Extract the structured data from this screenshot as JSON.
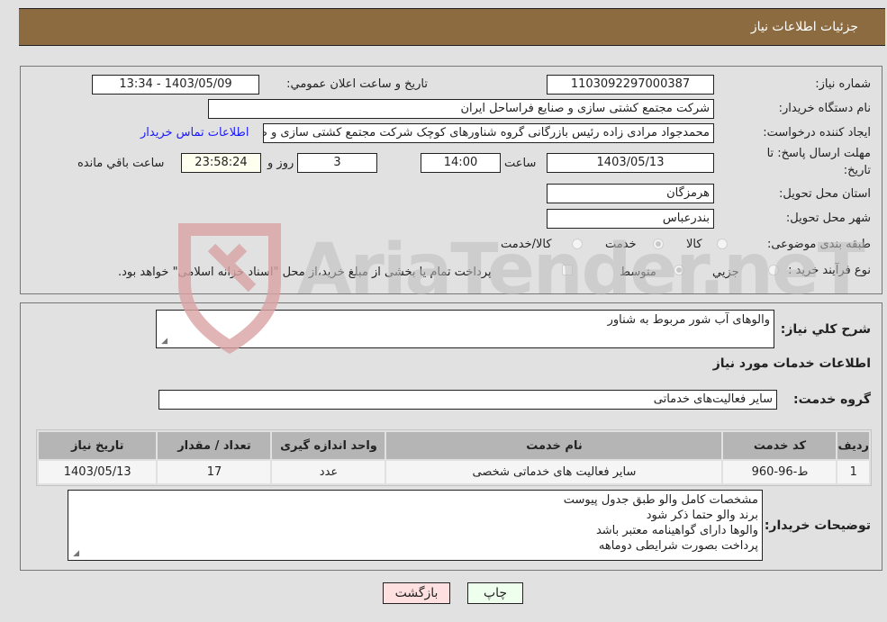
{
  "header": {
    "title": "جزئیات اطلاعات نیاز"
  },
  "info": {
    "need_number_label": "شماره نیاز:",
    "need_number": "1103092297000387",
    "announce_label": "تاریخ و ساعت اعلان عمومي:",
    "announce_value": "1403/05/09 - 13:34",
    "buyer_org_label": "نام دستگاه خریدار:",
    "buyer_org": "شرکت مجتمع کشتی سازی و صنایع فراساحل ایران",
    "creator_label": "ایجاد کننده درخواست:",
    "creator": "محمدجواد مرادی زاده رئیس بازرگانی گروه شناورهای کوچک  شرکت مجتمع کشتی سازی و صنایع فراساحل ایران",
    "contact_link": "اطلاعات تماس خریدار",
    "deadline_label_1": "مهلت ارسال پاسخ: تا",
    "deadline_label_2": "تاریخ:",
    "deadline_date": "1403/05/13",
    "time_label": "ساعت",
    "deadline_time": "14:00",
    "days_value": "3",
    "days_label": "روز و",
    "remaining_time": "23:58:24",
    "remaining_label": "ساعت باقي مانده",
    "province_label": "استان محل تحویل:",
    "province": "هرمزگان",
    "city_label": "شهر محل تحویل:",
    "city": "بندرعباس",
    "category_label": "طبقه بندی موضوعی:",
    "category_options": [
      {
        "label": "کالا",
        "selected": false
      },
      {
        "label": "خدمت",
        "selected": true
      },
      {
        "label": "کالا/خدمت",
        "selected": false
      }
    ],
    "process_label": "نوع فرآیند خرید :",
    "process_options": [
      {
        "label": "جزيي",
        "selected": false
      },
      {
        "label": "متوسط",
        "selected": true
      }
    ],
    "treasury_checkbox_checked": false,
    "treasury_text": "پرداخت تمام یا بخشی از مبلغ خرید،از محل \"اسناد خزانه اسلامی\" خواهد بود."
  },
  "details": {
    "summary_label": "شرح كلي نياز:",
    "summary": "والوهای آب شور مربوط به شناور",
    "services_heading": "اطلاعات خدمات مورد نیاز",
    "service_group_label": "گروه خدمت:",
    "service_group": "سایر فعالیت‌های خدماتی",
    "table": {
      "headers": [
        "ردیف",
        "کد خدمت",
        "نام خدمت",
        "واحد اندازه گیری",
        "تعداد / مقدار",
        "تاریخ نیاز"
      ],
      "rows": [
        [
          "1",
          "ط-96-960",
          "سایر فعالیت های خدماتی شخصی",
          "عدد",
          "17",
          "1403/05/13"
        ]
      ]
    },
    "buyer_notes_label": "توضیحات خریدار:",
    "buyer_notes": [
      "مشخصات کامل والو طبق جدول پیوست",
      "برند والو حتما ذکر شود",
      "والوها دارای گواهینامه معتبر باشد",
      "پرداخت بصورت شرایطی دوماهه"
    ]
  },
  "buttons": {
    "print": "چاپ",
    "back": "بازگشت"
  },
  "colors": {
    "header_bg": "#8c6b40",
    "print_bg": "#eeffee",
    "back_bg": "#ffe0e0",
    "link": "#1a1aff"
  },
  "watermark": {
    "text": "AriaTender.neT"
  }
}
